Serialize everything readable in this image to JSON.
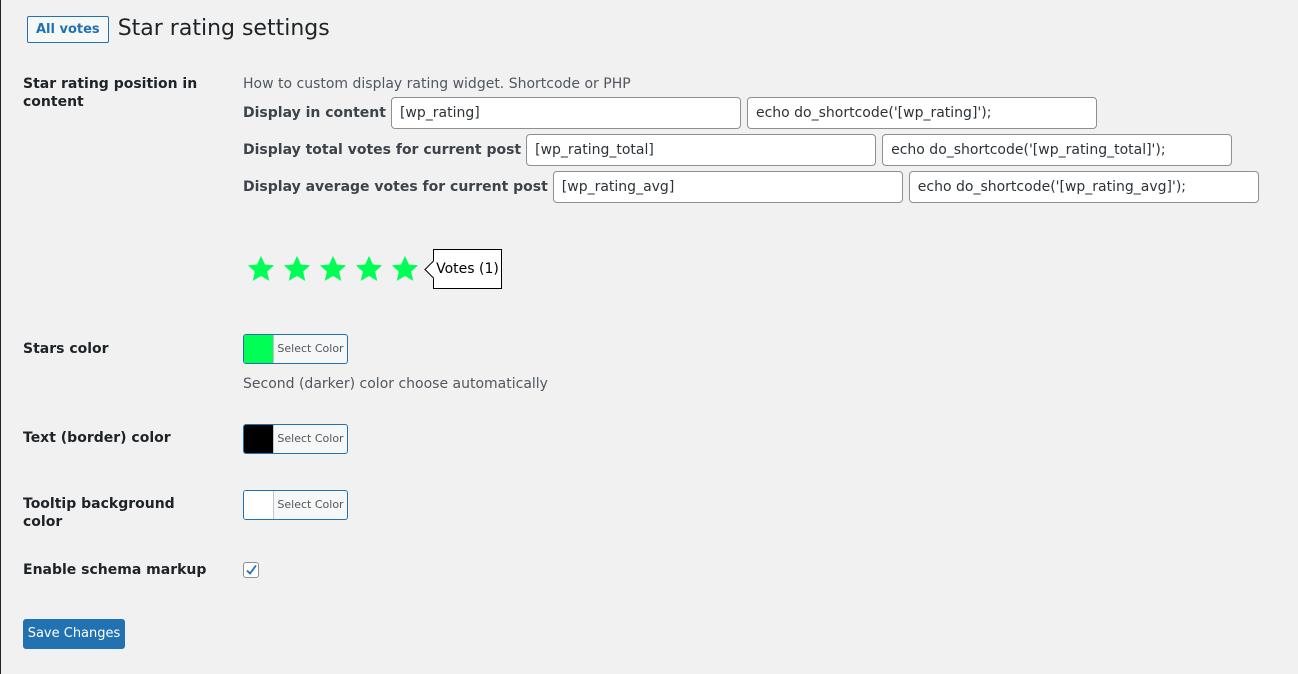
{
  "header": {
    "all_votes_label": "All votes",
    "title": "Star rating settings"
  },
  "position_section": {
    "label": "Star rating position in content",
    "description": "How to custom display rating widget. Shortcode or PHP",
    "rows": [
      {
        "label": "Display in content",
        "shortcode": "[wp_rating]",
        "php": "echo do_shortcode('[wp_rating]');"
      },
      {
        "label": "Display total votes for current post",
        "shortcode": "[wp_rating_total]",
        "php": "echo do_shortcode('[wp_rating_total]');"
      },
      {
        "label": "Display average votes for current post",
        "shortcode": "[wp_rating_avg]",
        "php": "echo do_shortcode('[wp_rating_avg]');"
      }
    ]
  },
  "preview": {
    "star_count": 5,
    "star_color": "#00ff55",
    "tooltip_text": "Votes (1)"
  },
  "stars_color": {
    "label": "Stars color",
    "button_label": "Select Color",
    "swatch": "#00ff55",
    "note": "Second (darker) color choose automatically"
  },
  "text_color": {
    "label": "Text (border) color",
    "button_label": "Select Color",
    "swatch": "#000000"
  },
  "tooltip_bg_color": {
    "label": "Tooltip background color",
    "button_label": "Select Color",
    "swatch": "#ffffff"
  },
  "schema": {
    "label": "Enable schema markup",
    "checked": true
  },
  "save_label": "Save Changes"
}
